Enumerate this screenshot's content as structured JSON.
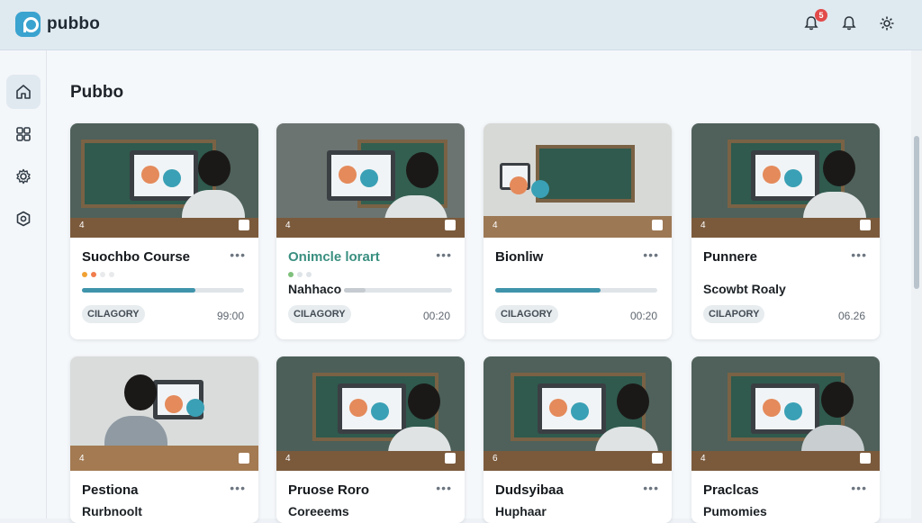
{
  "app": {
    "brand": "pubbo",
    "notification_count": "5"
  },
  "header": {
    "icons": [
      "bell-notification-icon",
      "bell-icon",
      "settings-icon"
    ]
  },
  "sidebar": {
    "items": [
      {
        "name": "home-icon",
        "active": true
      },
      {
        "name": "grid-icon",
        "active": false
      },
      {
        "name": "gear-icon",
        "active": false
      },
      {
        "name": "shield-gear-icon",
        "active": false
      }
    ]
  },
  "page": {
    "title": "Pubbo"
  },
  "cards": [
    {
      "title": "Suochbo Course",
      "subtitle": "",
      "progress": 0.7,
      "chip": "CILAGORY",
      "time": "99:00",
      "thumb_num": "4",
      "title_teal": false
    },
    {
      "title": "Onimcle lorart",
      "subtitle": "Nahhaco",
      "progress": 0.4,
      "chip": "CILAGORY",
      "time": "00:20",
      "thumb_num": "4",
      "title_teal": true
    },
    {
      "title": "Bionliw",
      "subtitle": "",
      "progress": 0.65,
      "chip": "CILAGORY",
      "time": "00:20",
      "thumb_num": "4",
      "title_teal": false
    },
    {
      "title": "Punnere",
      "subtitle": "Scowbt Roaly",
      "progress": 0,
      "chip": "CILAPORY",
      "time": "06.26",
      "thumb_num": "4",
      "title_teal": false
    },
    {
      "title": "Pestiona",
      "subtitle": "Rurbnoolt",
      "thumb_num": "4"
    },
    {
      "title": "Pruose Roro",
      "subtitle": "Coreeems",
      "thumb_num": "4"
    },
    {
      "title": "Dudsyibaa",
      "subtitle": "Huphaar",
      "thumb_num": "6"
    },
    {
      "title": "Praclcas",
      "subtitle": "Pumomies",
      "thumb_num": "4"
    }
  ],
  "colors": {
    "accent": "#3aa3cf",
    "progress": "#3f94ab",
    "badge": "#e24a4a"
  }
}
